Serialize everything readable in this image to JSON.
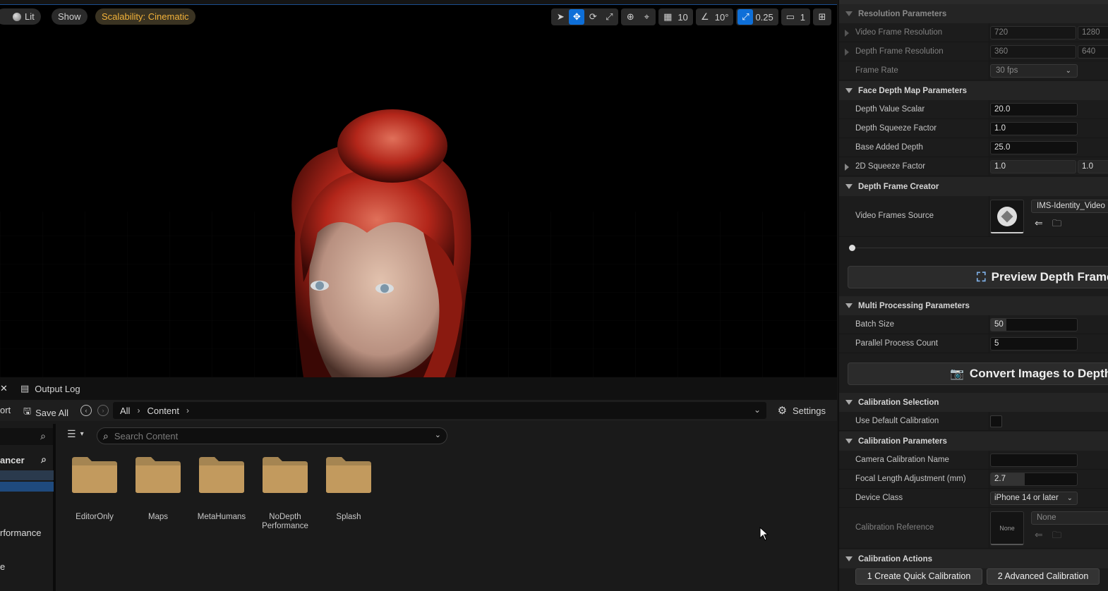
{
  "viewport": {
    "lit_label": "Lit",
    "show_label": "Show",
    "scalability_label": "Scalability: Cinematic",
    "grid_snap": "10",
    "rotation_snap": "10°",
    "scale_snap": "0.25",
    "camera_speed": "1"
  },
  "bottom": {
    "tab_output_log": "Output Log",
    "toolbar_fragment": "ort",
    "save_all": "Save All",
    "path": [
      "All",
      "Content"
    ],
    "settings": "Settings",
    "search_placeholder": "Search Content",
    "left_filter_fragment": "ancer",
    "left_items": [
      "rformance",
      "e"
    ],
    "folders": [
      "EditorOnly",
      "Maps",
      "MetaHumans",
      "NoDepth Performance",
      "Splash"
    ]
  },
  "details": {
    "sections": {
      "resolution": "Resolution Parameters",
      "face_depth": "Face Depth Map Parameters",
      "depth_creator": "Depth Frame Creator",
      "multi": "Multi Processing Parameters",
      "calib_sel": "Calibration Selection",
      "calib_params": "Calibration Parameters",
      "calib_actions": "Calibration Actions"
    },
    "video_frame_resolution": {
      "label": "Video Frame Resolution",
      "v1": "720",
      "v2": "1280"
    },
    "depth_frame_resolution": {
      "label": "Depth Frame Resolution",
      "v1": "360",
      "v2": "640"
    },
    "frame_rate": {
      "label": "Frame Rate",
      "value": "30 fps"
    },
    "depth_value_scalar": {
      "label": "Depth Value Scalar",
      "value": "20.0"
    },
    "depth_squeeze_factor": {
      "label": "Depth Squeeze Factor",
      "value": "1.0"
    },
    "base_added_depth": {
      "label": "Base Added Depth",
      "value": "25.0"
    },
    "squeeze_2d": {
      "label": "2D Squeeze Factor",
      "v1": "1.0",
      "v2": "1.0"
    },
    "video_frames_source": {
      "label": "Video Frames Source",
      "value": "IMS-Identity_Video"
    },
    "preview_button": "Preview Depth Frame",
    "batch_size": {
      "label": "Batch Size",
      "value": "50"
    },
    "parallel_count": {
      "label": "Parallel Process Count",
      "value": "5"
    },
    "convert_button": "Convert Images to Depth F",
    "use_default_calibration": "Use Default Calibration",
    "camera_calibration_name": {
      "label": "Camera Calibration Name",
      "value": ""
    },
    "focal_length": {
      "label": "Focal Length Adjustment (mm)",
      "value": "2.7"
    },
    "device_class": {
      "label": "Device Class",
      "value": "iPhone 14 or later"
    },
    "calibration_reference": {
      "label": "Calibration Reference",
      "thumb": "None",
      "value": "None"
    },
    "quick_calibration": "1 Create Quick Calibration",
    "advanced_calibration": "2 Advanced Calibration"
  }
}
